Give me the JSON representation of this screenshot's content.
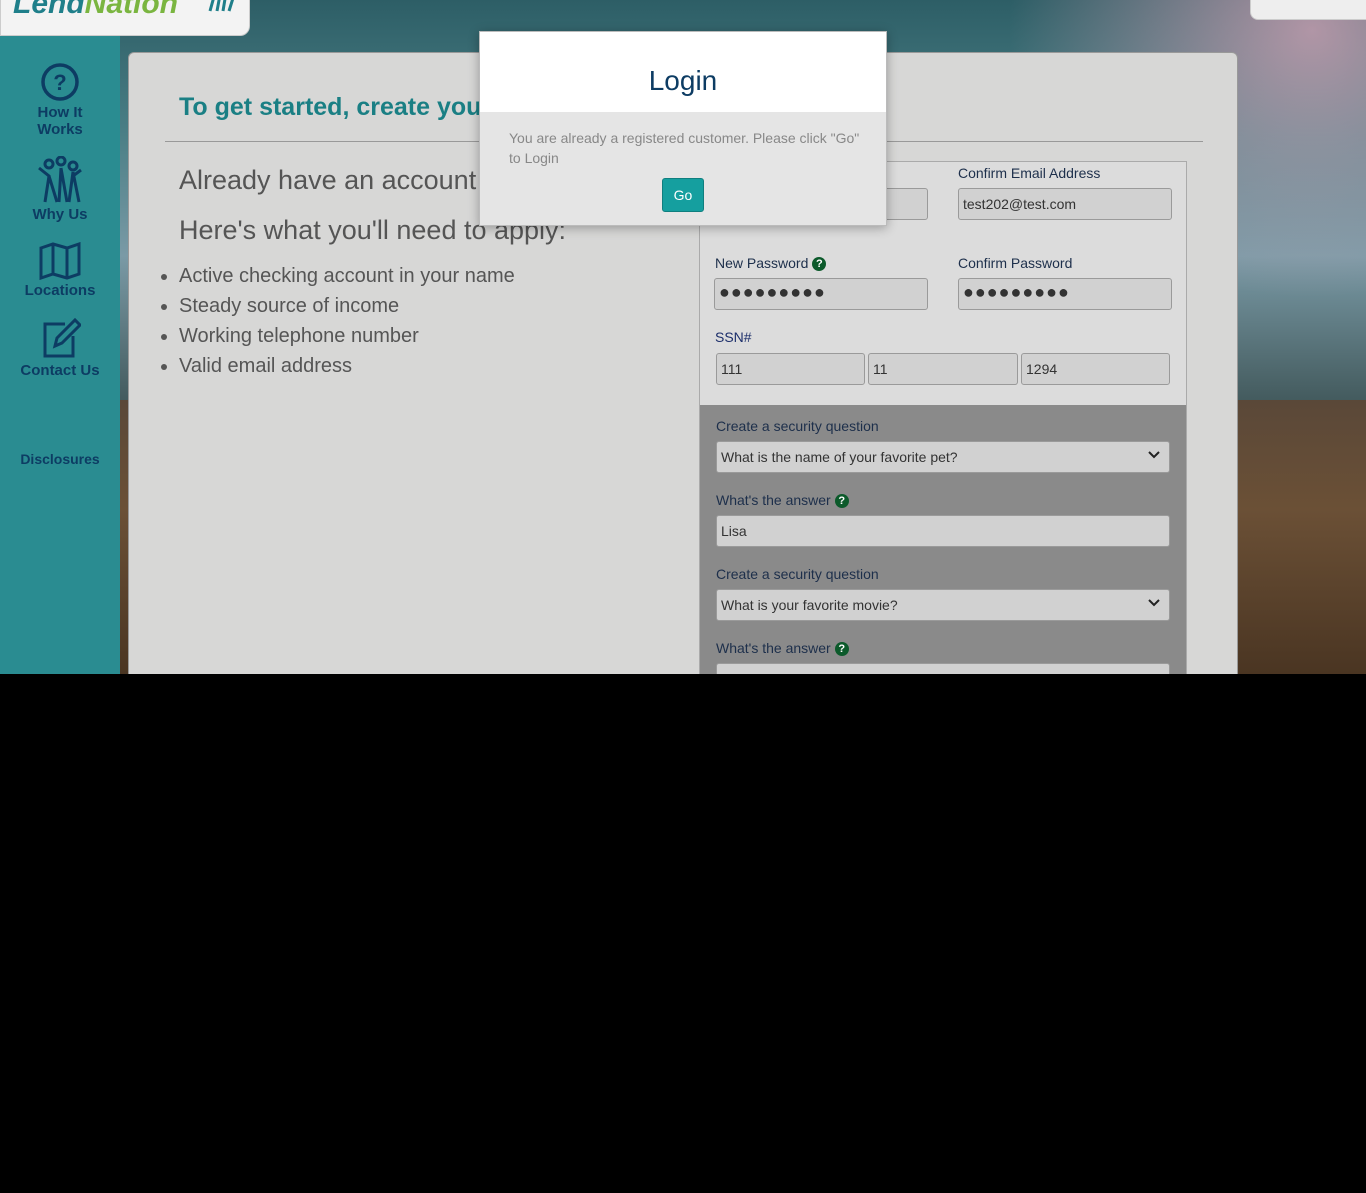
{
  "logo": {
    "lend": "Lend",
    "nation": "Nation"
  },
  "sidebar": {
    "items": [
      {
        "label_line1": "How It",
        "label_line2": "Works",
        "icon": "question-circle-icon"
      },
      {
        "label": "Why Us",
        "icon": "people-icon"
      },
      {
        "label": "Locations",
        "icon": "map-icon"
      },
      {
        "label": "Contact Us",
        "icon": "edit-icon"
      }
    ],
    "disclosures": "Disclosures"
  },
  "main": {
    "heading": "To get started, create your a",
    "already": "Already have an account",
    "need": "Here's what you'll need to apply:",
    "requirements": [
      "Active checking account in your name",
      "Steady source of income",
      "Working telephone number",
      "Valid email address"
    ]
  },
  "form": {
    "confirm_email_label": "Confirm Email Address",
    "confirm_email_value": "test202@test.com",
    "new_password_label": "New Password",
    "new_password_value": "●●●●●●●●●",
    "confirm_password_label": "Confirm Password",
    "confirm_password_value": "●●●●●●●●●",
    "ssn_label": "SSN#",
    "ssn_1": "111",
    "ssn_2": "11",
    "ssn_3": "1294",
    "security_q1_label": "Create a security question",
    "security_q1_value": "What is the name of your favorite pet?",
    "answer1_label": "What's the answer",
    "answer1_value": "Lisa",
    "security_q2_label": "Create a security question",
    "security_q2_value": "What is your favorite movie?",
    "answer2_label": "What's the answer",
    "help_glyph": "?"
  },
  "modal": {
    "title": "Login",
    "message": "You are already a registered customer. Please click \"Go\" to Login",
    "go_label": "Go"
  },
  "colors": {
    "accent": "#159f9f",
    "brand_teal": "#1f7f8a",
    "brand_green": "#7ab540",
    "navy": "#0d3c63"
  }
}
